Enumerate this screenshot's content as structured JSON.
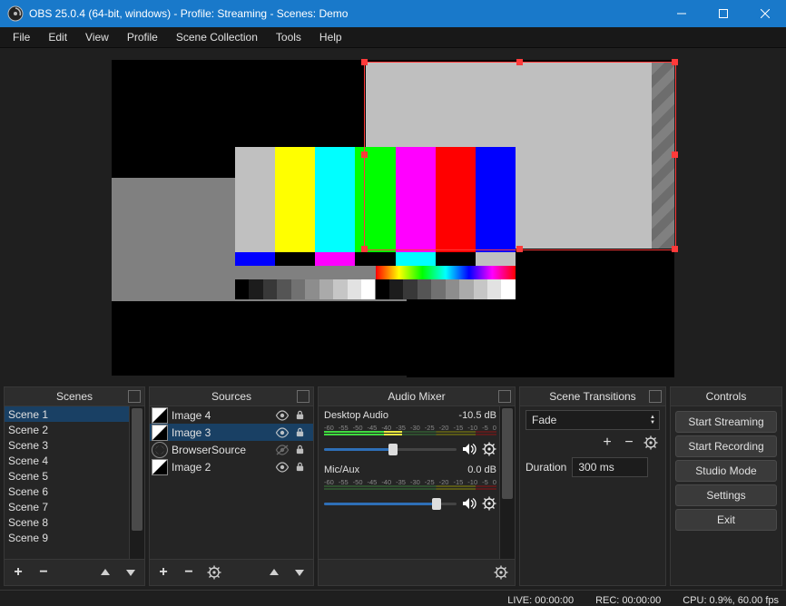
{
  "title": "OBS 25.0.4 (64-bit, windows) - Profile: Streaming - Scenes: Demo",
  "menu": [
    "File",
    "Edit",
    "View",
    "Profile",
    "Scene Collection",
    "Tools",
    "Help"
  ],
  "panels": {
    "scenes": {
      "title": "Scenes",
      "items": [
        "Scene 1",
        "Scene 2",
        "Scene 3",
        "Scene 4",
        "Scene 5",
        "Scene 6",
        "Scene 7",
        "Scene 8",
        "Scene 9"
      ],
      "selected_index": 0
    },
    "sources": {
      "title": "Sources",
      "items": [
        {
          "name": "Image 4",
          "type": "image",
          "visible": true,
          "locked": true
        },
        {
          "name": "Image 3",
          "type": "image",
          "visible": true,
          "locked": true
        },
        {
          "name": "BrowserSource",
          "type": "browser",
          "visible": false,
          "locked": true
        },
        {
          "name": "Image 2",
          "type": "image",
          "visible": true,
          "locked": true
        }
      ],
      "selected_index": 1
    },
    "mixer": {
      "title": "Audio Mixer",
      "ticks": [
        "-60",
        "-55",
        "-50",
        "-45",
        "-40",
        "-35",
        "-30",
        "-25",
        "-20",
        "-15",
        "-10",
        "-5",
        "0"
      ],
      "channels": [
        {
          "name": "Desktop Audio",
          "db": "-10.5 dB",
          "level_pct": 45,
          "fader_pct": 52
        },
        {
          "name": "Mic/Aux",
          "db": "0.0 dB",
          "level_pct": 0,
          "fader_pct": 85
        }
      ]
    },
    "transitions": {
      "title": "Scene Transitions",
      "current": "Fade",
      "duration_label": "Duration",
      "duration": "300 ms"
    },
    "controls": {
      "title": "Controls",
      "buttons": [
        "Start Streaming",
        "Start Recording",
        "Studio Mode",
        "Settings",
        "Exit"
      ]
    }
  },
  "status": {
    "live": "LIVE: 00:00:00",
    "rec": "REC: 00:00:00",
    "cpu": "CPU: 0.9%, 60.00 fps"
  }
}
